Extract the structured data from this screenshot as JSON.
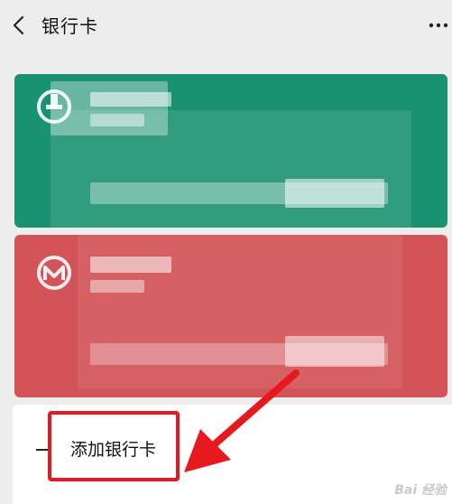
{
  "header": {
    "back_icon": "chevron-left-icon",
    "title": "银行卡",
    "more_icon": "more-dots-icon"
  },
  "cards": [
    {
      "color": "#1a9170",
      "logo_icon": "bank-logo-icon"
    },
    {
      "color": "#d35458",
      "logo_icon": "bank-logo-icon"
    }
  ],
  "add_card": {
    "plus_icon": "plus-icon",
    "label": "添加银行卡"
  },
  "annotation": {
    "highlight_color": "#e8191e"
  },
  "watermark": {
    "text": "Bai 经验"
  }
}
